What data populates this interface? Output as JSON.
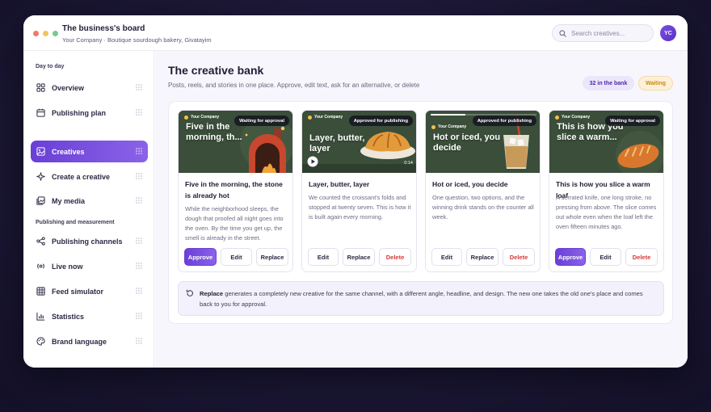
{
  "window": {
    "title": "The business's board",
    "subtitle": "Your Company · Boutique sourdough bakery, Givatayim",
    "dots": [
      "#ef7a6c",
      "#f1c55a",
      "#74cc8c"
    ]
  },
  "search": {
    "placeholder": "Search creatives..."
  },
  "user": {
    "initials": "YC"
  },
  "sidebar": {
    "sections": [
      {
        "label": "Day to day"
      },
      {
        "label": "Publishing and measurement"
      }
    ],
    "items": [
      {
        "label": "Overview",
        "icon": "grid-icon",
        "active": false
      },
      {
        "label": "Publishing plan",
        "icon": "calendar-icon",
        "active": false
      },
      {
        "label": "Creatives",
        "icon": "image-icon",
        "active": true
      },
      {
        "label": "Create a creative",
        "icon": "sparkle-icon",
        "active": false
      },
      {
        "label": "My media",
        "icon": "gallery-icon",
        "active": false
      },
      {
        "label": "Publishing channels",
        "icon": "share-icon",
        "active": false
      },
      {
        "label": "Live now",
        "icon": "broadcast-icon",
        "active": false
      },
      {
        "label": "Feed simulator",
        "icon": "layout-grid-icon",
        "active": false
      },
      {
        "label": "Statistics",
        "icon": "bar-chart-icon",
        "active": false
      },
      {
        "label": "Brand language",
        "icon": "palette-icon",
        "active": false
      }
    ]
  },
  "main": {
    "title": "The creative bank",
    "description": "Posts, reels, and stories in one place. Approve, edit text, ask for an alternative, or delete",
    "badges": {
      "count": "32 in the bank",
      "waiting": "Waiting"
    },
    "cards": [
      {
        "brand": "Your Company",
        "headline": "Five in the morning, th...",
        "status": "Waiting for approval",
        "title": "Five in the morning, the stone is already hot",
        "body": "While the neighborhood sleeps, the dough that proofed all night goes into the oven. By the time you get up, the smell is already in the street.",
        "actions": [
          "Approve",
          "Edit",
          "Replace"
        ]
      },
      {
        "brand": "Your Company",
        "headline": "Layer, butter, layer",
        "status": "Approved for publishing",
        "duration": "0:14",
        "title": "Layer, butter, layer",
        "body": "We counted the croissant's folds and stopped at twenty seven. This is how it is built again every morning.",
        "actions": [
          "Edit",
          "Replace",
          "Delete"
        ]
      },
      {
        "brand": "Your Company",
        "headline": "Hot or iced, you decide",
        "status": "Approved for publishing",
        "story_progress": 0.33,
        "title": "Hot or iced, you decide",
        "body": "One question, two options, and the winning drink stands on the counter all week.",
        "actions": [
          "Edit",
          "Replace",
          "Delete"
        ]
      },
      {
        "brand": "Your Company",
        "headline": "This is how you slice a warm...",
        "status": "Waiting for approval",
        "title": "This is how you slice a warm loaf",
        "body": "A serrated knife, one long stroke, no pressing from above. The slice comes out whole even when the loaf left the oven fifteen minutes ago.",
        "actions": [
          "Approve",
          "Edit",
          "Delete"
        ]
      }
    ],
    "note": {
      "lead": "Replace",
      "text": " generates a completely new creative for the same channel, with a different angle, headline, and design. The new one takes the old one's place and comes back to you for approval."
    }
  },
  "colors": {
    "accent": "#6a3fd6",
    "danger": "#d23a3a",
    "thumb_bg": "#39503b",
    "waiting_badge": "#c98a14"
  }
}
